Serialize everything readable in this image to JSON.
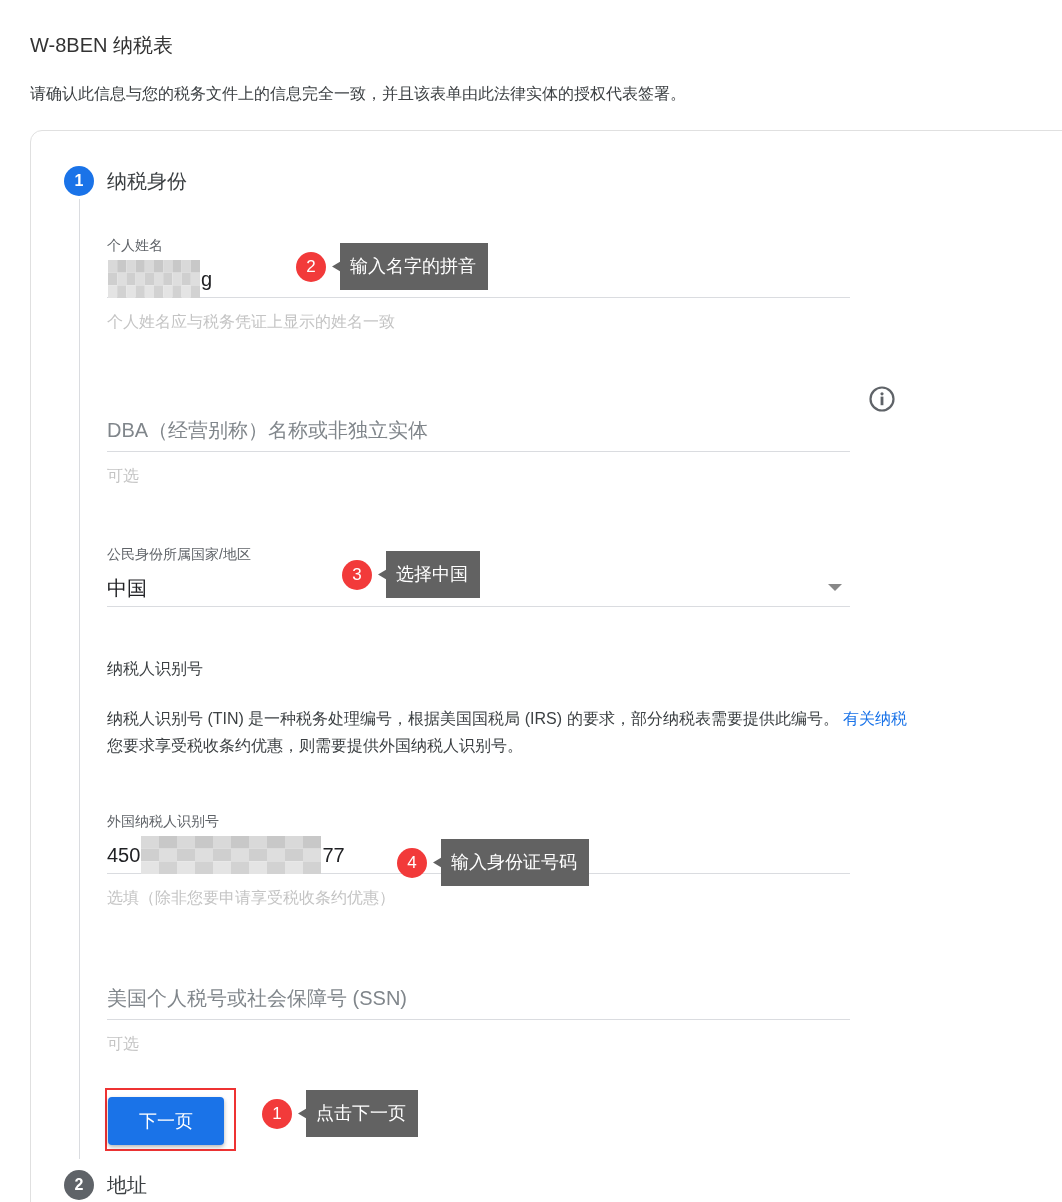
{
  "header": {
    "title": "W-8BEN 纳税表",
    "description": "请确认此信息与您的税务文件上的信息完全一致，并且该表单由此法律实体的授权代表签署。"
  },
  "steps": [
    {
      "number": "1",
      "label": "纳税身份",
      "active": true,
      "fields": [
        {
          "kind": "text",
          "label": "个人姓名",
          "value_after": "g",
          "redacted": true,
          "hint": "个人姓名应与税务凭证上显示的姓名一致",
          "annotation": {
            "number": "2",
            "text": "输入名字的拼音"
          }
        },
        {
          "kind": "text",
          "placeholder": "DBA（经营别称）名称或非独立实体",
          "hint": "可选",
          "info": true
        },
        {
          "kind": "select",
          "label": "公民身份所属国家/地区",
          "value": "中国",
          "annotation": {
            "number": "3",
            "text": "选择中国"
          }
        },
        {
          "kind": "info",
          "heading": "纳税人识别号",
          "text": "纳税人识别号 (TIN) 是一种税务处理编号，根据美国国税局 (IRS) 的要求，部分纳税表需要提供此编号。",
          "link": "有关纳税",
          "text_2": "您要求享受税收条约优惠，则需要提供外国纳税人识别号。"
        },
        {
          "kind": "text",
          "label": "外国纳税人识别号",
          "value_before": "450",
          "value_after": "77",
          "redacted": true,
          "hint": "选填（除非您要申请享受税收条约优惠）",
          "annotation": {
            "number": "4",
            "text": "输入身份证号码"
          }
        },
        {
          "kind": "text",
          "placeholder": "美国个人税号或社会保障号 (SSN)",
          "hint": "可选"
        }
      ],
      "button": {
        "label": "下一页",
        "highlighted": true,
        "annotation": {
          "number": "1",
          "text": "点击下一页"
        }
      }
    },
    {
      "number": "2",
      "label": "地址",
      "active": false
    }
  ]
}
